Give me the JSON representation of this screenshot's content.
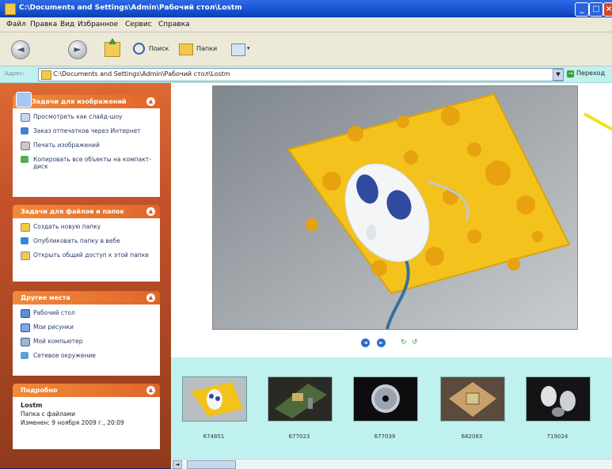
{
  "window": {
    "title": "C:\\Documents and Settings\\Admin\\Рабочий стол\\Lostm"
  },
  "menu": [
    "Файл",
    "Правка",
    "Вид",
    "Избранное",
    "Сервис",
    "Справка"
  ],
  "toolbar": {
    "search_label": "Поиск",
    "folders_label": "Папки"
  },
  "address": {
    "label": "Адрес:",
    "value": "C:\\Documents and Settings\\Admin\\Рабочий стол\\Lostm",
    "go_label": "Переход"
  },
  "panels": {
    "image_tasks": {
      "title": "Задачи для изображений",
      "items": [
        {
          "label": "Просмотреть как слайд-шоу",
          "icon": "slideshow-icon"
        },
        {
          "label": "Заказ отпечатков через Интернет",
          "icon": "order-prints-icon"
        },
        {
          "label": "Печать изображений",
          "icon": "print-icon"
        },
        {
          "label": "Копировать все объекты на компакт-диск",
          "icon": "cd-copy-icon"
        }
      ]
    },
    "file_tasks": {
      "title": "Задачи для файлов и папок",
      "items": [
        {
          "label": "Создать новую папку",
          "icon": "new-folder-icon"
        },
        {
          "label": "Опубликовать папку в вебе",
          "icon": "publish-web-icon"
        },
        {
          "label": "Открыть общий доступ к этой папке",
          "icon": "share-folder-icon"
        }
      ]
    },
    "other_places": {
      "title": "Другие места",
      "items": [
        {
          "label": "Рабочий стол",
          "icon": "desktop-icon"
        },
        {
          "label": "Мои рисунки",
          "icon": "my-pictures-icon"
        },
        {
          "label": "Мой компьютер",
          "icon": "my-computer-icon"
        },
        {
          "label": "Сетевое окружение",
          "icon": "network-icon"
        }
      ]
    },
    "details": {
      "title": "Подробно",
      "name": "Lostm",
      "type": "Папка с файлами",
      "modified": "Изменен: 9 ноября 2009 г., 20:09"
    }
  },
  "filmstrip": {
    "thumbs": [
      {
        "label": "674851",
        "subject": "mouse-on-pad"
      },
      {
        "label": "677023",
        "subject": "circuit-board"
      },
      {
        "label": "677039",
        "subject": "cd-disc"
      },
      {
        "label": "682083",
        "subject": "cpu-chip"
      },
      {
        "label": "719024",
        "subject": "mice"
      }
    ]
  },
  "colors": {
    "xp_title_blue": "#1752d0",
    "task_orange": "#e0662a",
    "filmstrip_cyan": "#bff2ef",
    "pad_yellow": "#f4c21c"
  }
}
